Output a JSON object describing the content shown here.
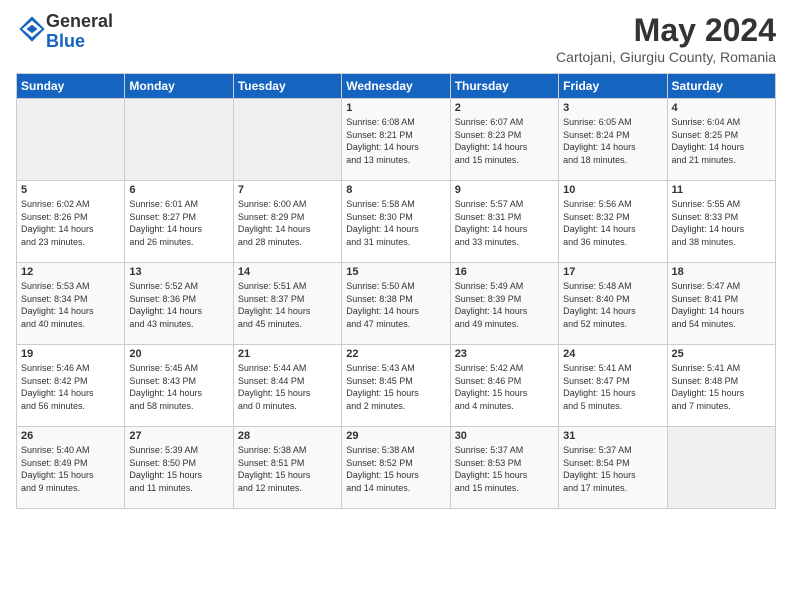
{
  "logo": {
    "general": "General",
    "blue": "Blue"
  },
  "title": "May 2024",
  "subtitle": "Cartojani, Giurgiu County, Romania",
  "days_of_week": [
    "Sunday",
    "Monday",
    "Tuesday",
    "Wednesday",
    "Thursday",
    "Friday",
    "Saturday"
  ],
  "weeks": [
    [
      {
        "day": "",
        "info": ""
      },
      {
        "day": "",
        "info": ""
      },
      {
        "day": "",
        "info": ""
      },
      {
        "day": "1",
        "info": "Sunrise: 6:08 AM\nSunset: 8:21 PM\nDaylight: 14 hours\nand 13 minutes."
      },
      {
        "day": "2",
        "info": "Sunrise: 6:07 AM\nSunset: 8:23 PM\nDaylight: 14 hours\nand 15 minutes."
      },
      {
        "day": "3",
        "info": "Sunrise: 6:05 AM\nSunset: 8:24 PM\nDaylight: 14 hours\nand 18 minutes."
      },
      {
        "day": "4",
        "info": "Sunrise: 6:04 AM\nSunset: 8:25 PM\nDaylight: 14 hours\nand 21 minutes."
      }
    ],
    [
      {
        "day": "5",
        "info": "Sunrise: 6:02 AM\nSunset: 8:26 PM\nDaylight: 14 hours\nand 23 minutes."
      },
      {
        "day": "6",
        "info": "Sunrise: 6:01 AM\nSunset: 8:27 PM\nDaylight: 14 hours\nand 26 minutes."
      },
      {
        "day": "7",
        "info": "Sunrise: 6:00 AM\nSunset: 8:29 PM\nDaylight: 14 hours\nand 28 minutes."
      },
      {
        "day": "8",
        "info": "Sunrise: 5:58 AM\nSunset: 8:30 PM\nDaylight: 14 hours\nand 31 minutes."
      },
      {
        "day": "9",
        "info": "Sunrise: 5:57 AM\nSunset: 8:31 PM\nDaylight: 14 hours\nand 33 minutes."
      },
      {
        "day": "10",
        "info": "Sunrise: 5:56 AM\nSunset: 8:32 PM\nDaylight: 14 hours\nand 36 minutes."
      },
      {
        "day": "11",
        "info": "Sunrise: 5:55 AM\nSunset: 8:33 PM\nDaylight: 14 hours\nand 38 minutes."
      }
    ],
    [
      {
        "day": "12",
        "info": "Sunrise: 5:53 AM\nSunset: 8:34 PM\nDaylight: 14 hours\nand 40 minutes."
      },
      {
        "day": "13",
        "info": "Sunrise: 5:52 AM\nSunset: 8:36 PM\nDaylight: 14 hours\nand 43 minutes."
      },
      {
        "day": "14",
        "info": "Sunrise: 5:51 AM\nSunset: 8:37 PM\nDaylight: 14 hours\nand 45 minutes."
      },
      {
        "day": "15",
        "info": "Sunrise: 5:50 AM\nSunset: 8:38 PM\nDaylight: 14 hours\nand 47 minutes."
      },
      {
        "day": "16",
        "info": "Sunrise: 5:49 AM\nSunset: 8:39 PM\nDaylight: 14 hours\nand 49 minutes."
      },
      {
        "day": "17",
        "info": "Sunrise: 5:48 AM\nSunset: 8:40 PM\nDaylight: 14 hours\nand 52 minutes."
      },
      {
        "day": "18",
        "info": "Sunrise: 5:47 AM\nSunset: 8:41 PM\nDaylight: 14 hours\nand 54 minutes."
      }
    ],
    [
      {
        "day": "19",
        "info": "Sunrise: 5:46 AM\nSunset: 8:42 PM\nDaylight: 14 hours\nand 56 minutes."
      },
      {
        "day": "20",
        "info": "Sunrise: 5:45 AM\nSunset: 8:43 PM\nDaylight: 14 hours\nand 58 minutes."
      },
      {
        "day": "21",
        "info": "Sunrise: 5:44 AM\nSunset: 8:44 PM\nDaylight: 15 hours\nand 0 minutes."
      },
      {
        "day": "22",
        "info": "Sunrise: 5:43 AM\nSunset: 8:45 PM\nDaylight: 15 hours\nand 2 minutes."
      },
      {
        "day": "23",
        "info": "Sunrise: 5:42 AM\nSunset: 8:46 PM\nDaylight: 15 hours\nand 4 minutes."
      },
      {
        "day": "24",
        "info": "Sunrise: 5:41 AM\nSunset: 8:47 PM\nDaylight: 15 hours\nand 5 minutes."
      },
      {
        "day": "25",
        "info": "Sunrise: 5:41 AM\nSunset: 8:48 PM\nDaylight: 15 hours\nand 7 minutes."
      }
    ],
    [
      {
        "day": "26",
        "info": "Sunrise: 5:40 AM\nSunset: 8:49 PM\nDaylight: 15 hours\nand 9 minutes."
      },
      {
        "day": "27",
        "info": "Sunrise: 5:39 AM\nSunset: 8:50 PM\nDaylight: 15 hours\nand 11 minutes."
      },
      {
        "day": "28",
        "info": "Sunrise: 5:38 AM\nSunset: 8:51 PM\nDaylight: 15 hours\nand 12 minutes."
      },
      {
        "day": "29",
        "info": "Sunrise: 5:38 AM\nSunset: 8:52 PM\nDaylight: 15 hours\nand 14 minutes."
      },
      {
        "day": "30",
        "info": "Sunrise: 5:37 AM\nSunset: 8:53 PM\nDaylight: 15 hours\nand 15 minutes."
      },
      {
        "day": "31",
        "info": "Sunrise: 5:37 AM\nSunset: 8:54 PM\nDaylight: 15 hours\nand 17 minutes."
      },
      {
        "day": "",
        "info": ""
      }
    ]
  ]
}
